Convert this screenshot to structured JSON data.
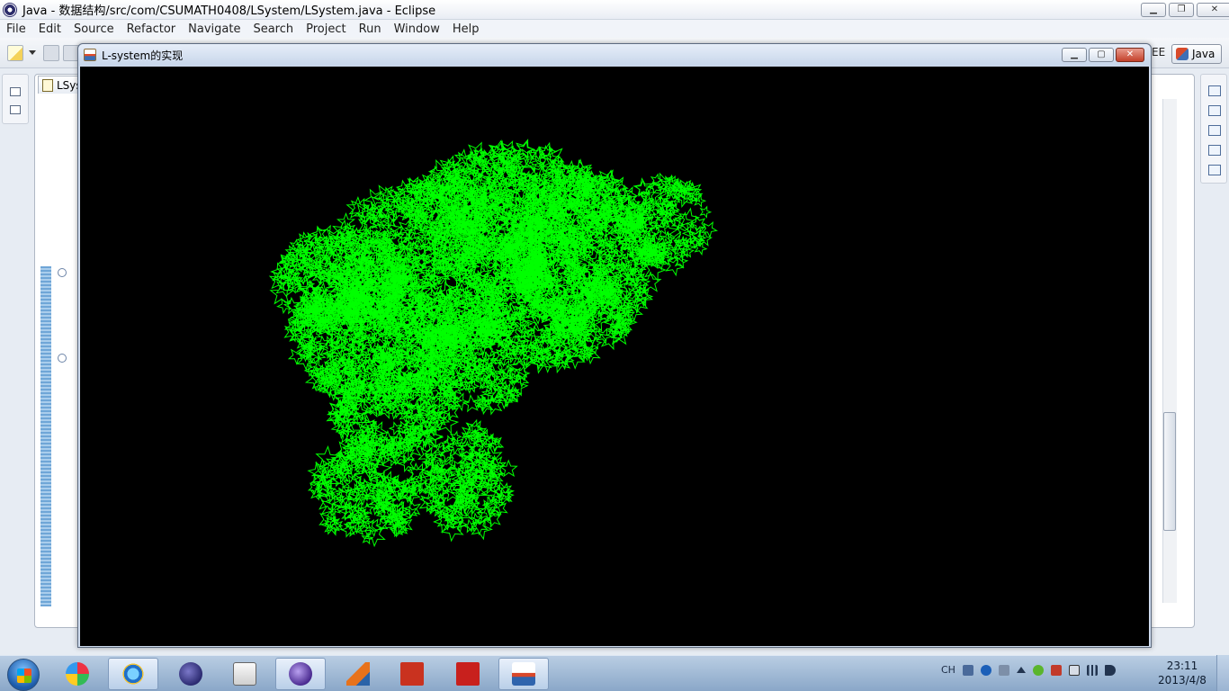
{
  "eclipse": {
    "title": "Java - 数据结构/src/com/CSUMATH0408/LSystem/LSystem.java - Eclipse",
    "menu": [
      "File",
      "Edit",
      "Source",
      "Refactor",
      "Navigate",
      "Search",
      "Project",
      "Run",
      "Window",
      "Help"
    ],
    "perspectives": {
      "ee_label": "EE",
      "java_label": "Java"
    },
    "editor_tab_label": "LSys"
  },
  "frame": {
    "title": "L-system的实现",
    "drawing_color": "#00ff00",
    "background": "#000000"
  },
  "taskbar": {
    "apps": [
      "start-orb-icon",
      "pinned-app-icon",
      "internet-explorer-icon",
      "eclipse-icon",
      "installer-icon",
      "eclipse-alt-icon",
      "matlab-icon",
      "coldfusion-icon",
      "acrobat-icon",
      "java-icon"
    ],
    "tray_language": "CH",
    "time": "23:11",
    "date": "2013/4/8"
  }
}
